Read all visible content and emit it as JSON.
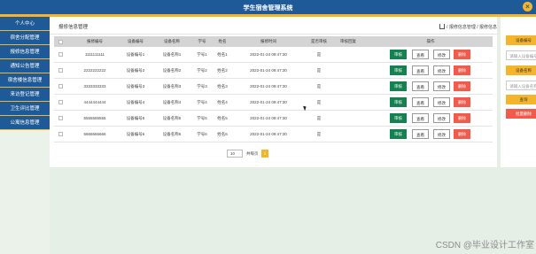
{
  "window": {
    "title": "学生宿舍管理系统"
  },
  "sidebar": {
    "items": [
      {
        "label": "个人中心"
      },
      {
        "label": "宿舍分配管理"
      },
      {
        "label": "报修信息管理"
      },
      {
        "label": "通知公告管理"
      },
      {
        "label": "宿舍楼信息管理"
      },
      {
        "label": "来访登记管理"
      },
      {
        "label": "卫生评比管理"
      },
      {
        "label": "公寓信息管理"
      }
    ]
  },
  "main": {
    "page_title": "报修信息管理",
    "breadcrumbs": "/ 报修信息管理 / 报修信息",
    "table": {
      "headers": [
        "报修编号",
        "设备编号",
        "设备名称",
        "学号",
        "姓名",
        "报修时间",
        "是否审核",
        "审核回复",
        "操作"
      ],
      "rows": [
        {
          "repair_no": "1111111111",
          "device_no": "设备编号1",
          "device_name": "设备名称1",
          "student_no": "学号1",
          "name": "姓名1",
          "time": "2022-01-24 09:47:30",
          "reviewed": "是",
          "reply": ""
        },
        {
          "repair_no": "2222222222",
          "device_no": "设备编号2",
          "device_name": "设备名称2",
          "student_no": "学号2",
          "name": "姓名2",
          "time": "2022-01-24 09:47:30",
          "reviewed": "是",
          "reply": ""
        },
        {
          "repair_no": "3333333333",
          "device_no": "设备编号3",
          "device_name": "设备名称3",
          "student_no": "学号3",
          "name": "姓名3",
          "time": "2022-01-24 09:47:30",
          "reviewed": "是",
          "reply": ""
        },
        {
          "repair_no": "4444444444",
          "device_no": "设备编号4",
          "device_name": "设备名称4",
          "student_no": "学号4",
          "name": "姓名4",
          "time": "2022-01-24 09:47:30",
          "reviewed": "是",
          "reply": ""
        },
        {
          "repair_no": "5555555555",
          "device_no": "设备编号5",
          "device_name": "设备名称5",
          "student_no": "学号5",
          "name": "姓名5",
          "time": "2022-01-24 09:47:30",
          "reviewed": "是",
          "reply": ""
        },
        {
          "repair_no": "6666666666",
          "device_no": "设备编号6",
          "device_name": "设备名称6",
          "student_no": "学号6",
          "name": "姓名6",
          "time": "2022-01-24 09:47:30",
          "reviewed": "是",
          "reply": ""
        }
      ],
      "actions": {
        "approve": "审核",
        "view": "查看",
        "edit": "修改",
        "delete": "删除"
      }
    },
    "pager": {
      "page_size": "10",
      "total_label": "共每页",
      "current_page": "1"
    }
  },
  "right_panel": {
    "label_1": "设备编号",
    "placeholder_1": "请输入设备编号",
    "label_2": "设备名称",
    "placeholder_2": "请输入设备名称",
    "search_label": "查询",
    "batch_delete_label": "批量删除"
  },
  "watermark": "CSDN @毕业设计工作室",
  "colors": {
    "primary": "#1f5a98",
    "accent": "#f5b52b",
    "approve": "#158050",
    "danger": "#f25b4b"
  }
}
